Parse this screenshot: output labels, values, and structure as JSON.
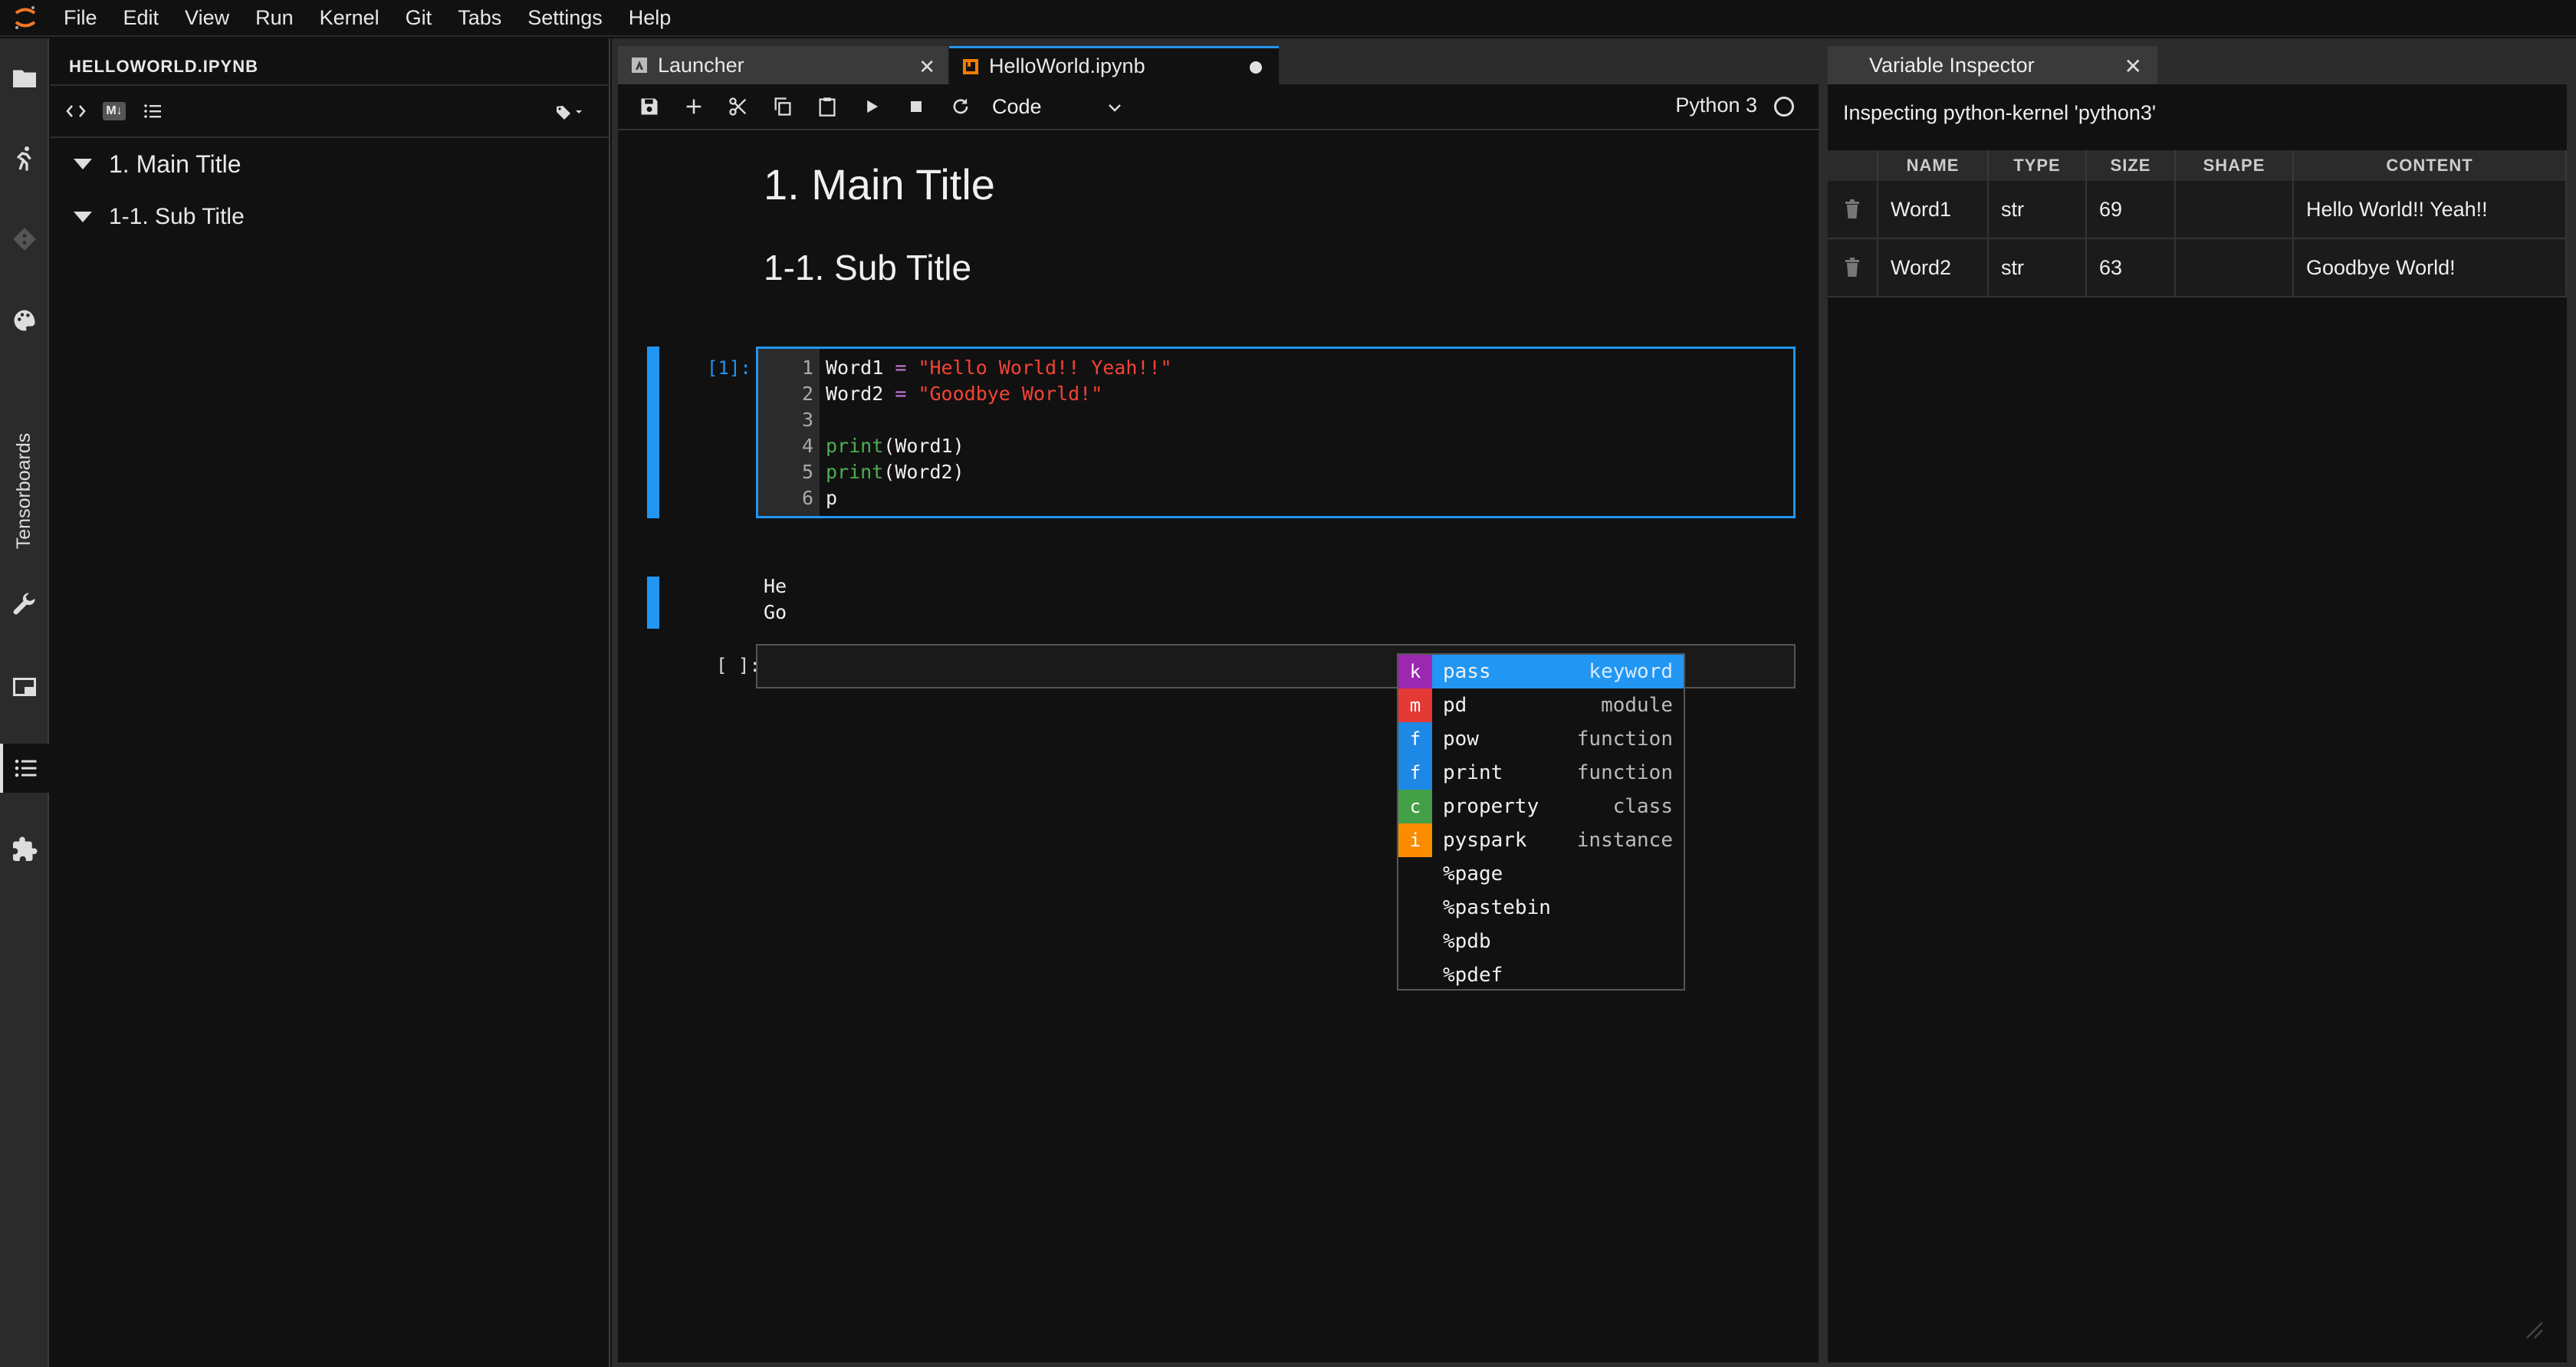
{
  "menubar": {
    "items": [
      "File",
      "Edit",
      "View",
      "Run",
      "Kernel",
      "Git",
      "Tabs",
      "Settings",
      "Help"
    ]
  },
  "sidebar": {
    "tensorboards_label": "Tensorboards",
    "icons": [
      "folder-icon",
      "running-icon",
      "git-icon",
      "palette-icon",
      "wrench-icon",
      "tabs-icon",
      "toc-icon",
      "extension-icon"
    ]
  },
  "toc": {
    "title": "HELLOWORLD.IPYNB",
    "md_label": "M↓",
    "entries": [
      {
        "text": "1. Main Title"
      },
      {
        "text": "1-1. Sub Title"
      }
    ]
  },
  "tabs": [
    {
      "label": "Launcher"
    },
    {
      "label": "HelloWorld.ipynb"
    }
  ],
  "toolbar": {
    "cell_type": "Code",
    "kernel": "Python 3"
  },
  "notebook": {
    "h1": "1. Main Title",
    "h2": "1-1. Sub Title",
    "cell1_prompt": "[1]:",
    "line_numbers": [
      "1",
      "2",
      "3",
      "4",
      "5",
      "6"
    ],
    "code": {
      "l1_var": "Word1 ",
      "l1_op": "=",
      "l1_str": "\"Hello World!! Yeah!!\"",
      "l2_var": "Word2 ",
      "l2_op": "=",
      "l2_str": "\"Goodbye World!\"",
      "l4_fn": "print",
      "l4_arg": "(Word1)",
      "l5_fn": "print",
      "l5_arg": "(Word2)",
      "l6": "p"
    },
    "output_lines": [
      "He",
      "Go"
    ],
    "cell2_prompt": "[ ]:"
  },
  "completer": {
    "items": [
      {
        "badge": "k",
        "badge_color": "#9c27b0",
        "label": "pass",
        "type": "keyword"
      },
      {
        "badge": "m",
        "badge_color": "#e53935",
        "label": "pd",
        "type": "module"
      },
      {
        "badge": "f",
        "badge_color": "#1e88e5",
        "label": "pow",
        "type": "function"
      },
      {
        "badge": "f",
        "badge_color": "#1e88e5",
        "label": "print",
        "type": "function"
      },
      {
        "badge": "c",
        "badge_color": "#43a047",
        "label": "property",
        "type": "class"
      },
      {
        "badge": "i",
        "badge_color": "#fb8c00",
        "label": "pyspark",
        "type": "instance"
      },
      {
        "badge": "",
        "badge_color": "",
        "label": "%page",
        "type": ""
      },
      {
        "badge": "",
        "badge_color": "",
        "label": "%pastebin",
        "type": ""
      },
      {
        "badge": "",
        "badge_color": "",
        "label": "%pdb",
        "type": ""
      },
      {
        "badge": "",
        "badge_color": "",
        "label": "%pdef",
        "type": ""
      }
    ]
  },
  "inspector": {
    "tab_label": "Variable Inspector",
    "header": "Inspecting python-kernel 'python3'",
    "columns": [
      "NAME",
      "TYPE",
      "SIZE",
      "SHAPE",
      "CONTENT"
    ],
    "rows": [
      {
        "name": "Word1",
        "type": "str",
        "size": "69",
        "shape": "",
        "content": "Hello World!! Yeah!!"
      },
      {
        "name": "Word2",
        "type": "str",
        "size": "63",
        "shape": "",
        "content": "Goodbye World!"
      }
    ]
  },
  "colors": {
    "accent": "#2196f3",
    "background": "#111111",
    "panel": "#2b2b2b"
  }
}
